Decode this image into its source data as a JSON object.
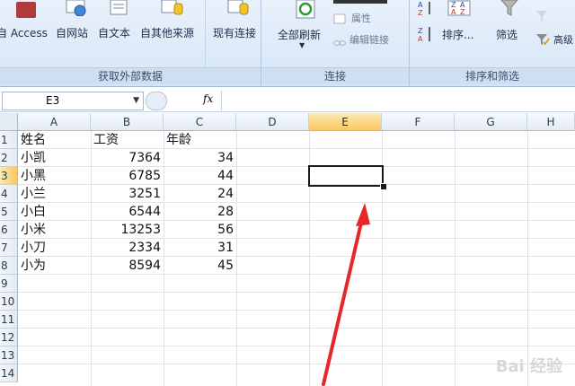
{
  "ribbon": {
    "get_external": {
      "label": "获取外部数据",
      "buttons": [
        "自 Access",
        "自网站",
        "自文本",
        "自其他来源",
        "现有连接"
      ]
    },
    "connections": {
      "label": "连接",
      "refresh_all": "全部刷新",
      "properties": "属性",
      "edit_links": "编辑链接"
    },
    "sort_filter": {
      "label": "排序和筛选",
      "sort": "排序...",
      "filter": "筛选",
      "advanced": "高级"
    }
  },
  "formula_bar": {
    "name_box": "E3",
    "fx": "fx",
    "formula": ""
  },
  "columns": [
    "A",
    "B",
    "C",
    "D",
    "E",
    "F",
    "G",
    "H"
  ],
  "selected_column": "E",
  "rows": [
    "1",
    "2",
    "3",
    "4",
    "5",
    "6",
    "7",
    "8",
    "9",
    "10",
    "11",
    "12",
    "13",
    "14"
  ],
  "selected_row": "3",
  "sheet": {
    "headers": [
      "姓名",
      "工资",
      "年龄"
    ],
    "data": [
      {
        "name": "小凯",
        "salary": "7364",
        "age": "34"
      },
      {
        "name": "小黑",
        "salary": "6785",
        "age": "44"
      },
      {
        "name": "小兰",
        "salary": "3251",
        "age": "24"
      },
      {
        "name": "小白",
        "salary": "6544",
        "age": "28"
      },
      {
        "name": "小米",
        "salary": "13253",
        "age": "56"
      },
      {
        "name": "小刀",
        "salary": "2334",
        "age": "31"
      },
      {
        "name": "小为",
        "salary": "8594",
        "age": "45"
      }
    ]
  },
  "watermark": "Bai 经验",
  "colors": {
    "arrow": "#e8262a",
    "selection": "#1a1a1a"
  }
}
